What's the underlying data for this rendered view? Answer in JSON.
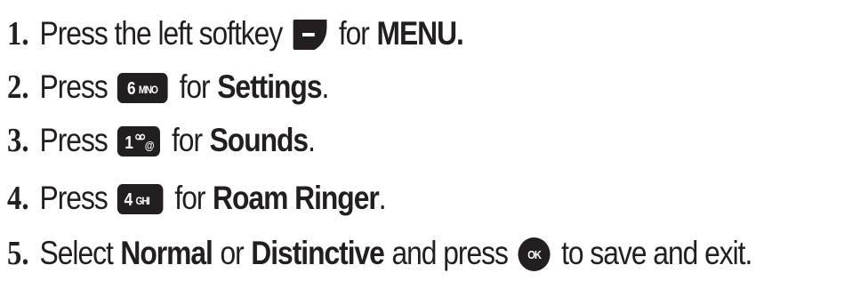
{
  "steps": [
    {
      "number": "1.",
      "text_before": "Press the left softkey",
      "icon": "left-softkey-icon",
      "text_after": "for",
      "bold": "MENU.",
      "trailing": ""
    },
    {
      "number": "2.",
      "text_before": "Press",
      "icon": "key-6-mno-icon",
      "key_digit": "6",
      "key_letters": "MNO",
      "text_after": "for",
      "bold": "Settings",
      "trailing": "."
    },
    {
      "number": "3.",
      "text_before": "Press",
      "icon": "key-1-voicemail-icon",
      "key_digit": "1",
      "key_letters": "ᴼᴼ@",
      "text_after": "for",
      "bold": "Sounds",
      "trailing": "."
    },
    {
      "number": "4.",
      "text_before": "Press",
      "icon": "key-4-ghi-icon",
      "key_digit": "4",
      "key_letters": "GHI",
      "text_after": "for",
      "bold": "Roam Ringer",
      "trailing": "."
    },
    {
      "number": "5.",
      "text_select": "Select",
      "option1": "Normal",
      "or": "or",
      "option2": "Distinctive",
      "and_press": "and press",
      "icon": "ok-key-icon",
      "ok_label": "OK",
      "ending": "to save and exit."
    }
  ],
  "colors": {
    "text": "#231f20",
    "key_fill": "#231f20",
    "key_text": "#ffffff"
  }
}
